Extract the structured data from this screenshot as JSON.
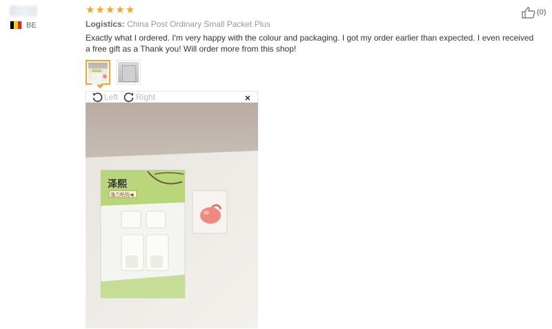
{
  "reviewer": {
    "country_code": "BE"
  },
  "review": {
    "rating": 5,
    "logistics_label": "Logistics:",
    "logistics_value": "China Post Ordinary Small Packet Plus",
    "text": "Exactly what I ordered. I'm very happy with the colour and packaging. I got my order earlier than expected. I even received a free gift as a Thank you! Will order more from this shop!",
    "helpful_count": "(0)"
  },
  "viewer": {
    "rotate_left_label": "Left",
    "rotate_right_label": "Right",
    "close_label": "×"
  },
  "product_photo": {
    "brand_text": "泽熙",
    "tag_text": "强力粘钩◀"
  },
  "colors": {
    "star": "#f5a623",
    "thumb_active_border": "#f5a623",
    "card_green": "#b9d67a"
  },
  "icons": [
    "star-icon",
    "rotate-left-icon",
    "rotate-right-icon",
    "close-icon",
    "thumbs-up-icon",
    "flag-belgium-icon"
  ]
}
